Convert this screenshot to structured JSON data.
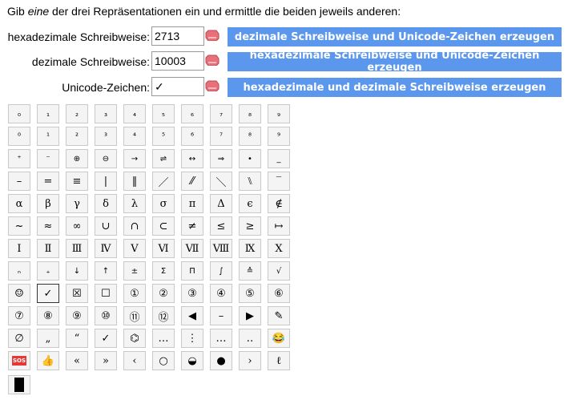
{
  "intro": {
    "pre": "Gib ",
    "em": "eine",
    "post": " der drei Repräsentationen ein und ermittle die beiden jeweils anderen:"
  },
  "rows": [
    {
      "label": "hexadezimale Schreibweise:",
      "value": "2713",
      "button": "dezimale Schreibweise und Unicode-Zeichen erzeugen"
    },
    {
      "label": "dezimale Schreibweise:",
      "value": "10003",
      "button": "hexadezimale Schreibweise und Unicode-Zeichen erzeugen"
    },
    {
      "label": "Unicode-Zeichen:",
      "value": "✓",
      "button": "hexadezimale und dezimale Schreibweise erzeugen"
    }
  ],
  "colors": {
    "button": "#5b97ec",
    "eraser": "#e8707a"
  },
  "icons": {
    "eraser": "eraser-icon",
    "sos": "sos-icon",
    "thumbs_up": "thumbs-up-icon",
    "pencil": "pencil-icon",
    "laughing": "laughing-face-icon",
    "block": "black-block-icon"
  },
  "grid": [
    [
      "₀",
      "₁",
      "₂",
      "₃",
      "₄",
      "₅",
      "₆",
      "₇",
      "₈",
      "₉"
    ],
    [
      "⁰",
      "¹",
      "²",
      "³",
      "⁴",
      "⁵",
      "⁶",
      "⁷",
      "⁸",
      "⁹"
    ],
    [
      "⁺",
      "⁻",
      "⊕",
      "⊖",
      "→",
      "⇌",
      "↔",
      "⇒",
      "•",
      "_"
    ],
    [
      "–",
      "=",
      "≡",
      "|",
      "‖",
      "／",
      "⁄⁄",
      "＼",
      "⑊",
      "‾"
    ],
    [
      "α",
      "β",
      "γ",
      "δ",
      "λ",
      "σ",
      "π",
      "Δ",
      "ϵ",
      "∉"
    ],
    [
      "~",
      "≈",
      "∞",
      "∪",
      "∩",
      "⊂",
      "≠",
      "≤",
      "≥",
      "↦"
    ],
    [
      "Ⅰ",
      "Ⅱ",
      "Ⅲ",
      "Ⅳ",
      "Ⅴ",
      "Ⅵ",
      "Ⅶ",
      "Ⅷ",
      "Ⅸ",
      "Ⅹ"
    ],
    [
      "ₙ",
      "₊",
      "↓",
      "↑",
      "±",
      "Σ",
      "Π",
      "∫",
      "≙",
      "√"
    ],
    [
      "☺",
      "✓",
      "☒",
      "☐",
      "①",
      "②",
      "③",
      "④",
      "⑤",
      "⑥"
    ],
    [
      "⑦",
      "⑧",
      "⑨",
      "⑩",
      "⑪",
      "⑫",
      "◀",
      "–",
      "▶",
      "✎"
    ],
    [
      "∅",
      "„",
      "“",
      "✓",
      "⌬",
      "…",
      "⋮",
      "…",
      "‥",
      "😂"
    ],
    [
      "SOS",
      "👍",
      "«",
      "»",
      "‹",
      "○",
      "◒",
      "●",
      "›",
      "ℓ"
    ],
    [
      "█"
    ]
  ]
}
